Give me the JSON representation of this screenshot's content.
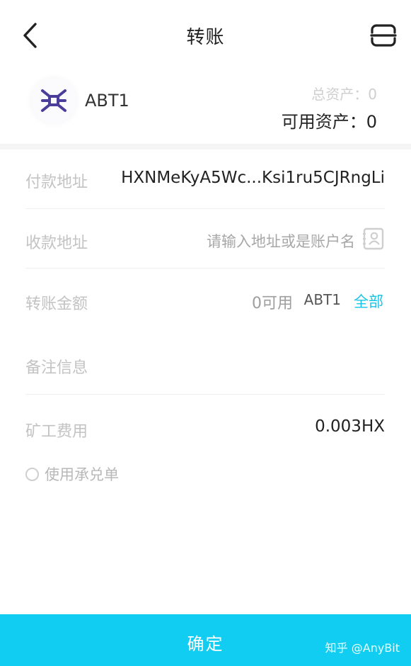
{
  "header": {
    "title": "转账",
    "back_icon": "chevron-left-icon",
    "scan_icon": "scan-icon"
  },
  "asset": {
    "coin_name": "ABT1",
    "total_label": "总资产：0",
    "available_label": "可用资产：0",
    "logo_color": "#4a3e9a"
  },
  "form": {
    "payer": {
      "label": "付款地址",
      "value": "HXNMeKyA5Wc...Ksi1ru5CJRngLi"
    },
    "payee": {
      "label": "收款地址",
      "placeholder": "请输入地址或是账户名",
      "icon": "contact-card-icon"
    },
    "amount": {
      "label": "转账金额",
      "available": "0可用",
      "coin": "ABT1",
      "all_link": "全部",
      "accent": "#18c3e6"
    },
    "memo": {
      "label": "备注信息"
    },
    "fee": {
      "label": "矿工费用",
      "value": "0.003HX"
    },
    "acceptance": {
      "label": "使用承兑单"
    }
  },
  "footer": {
    "confirm_label": "确定",
    "color": "#10cdf1",
    "watermark": "知乎 @AnyBit"
  }
}
